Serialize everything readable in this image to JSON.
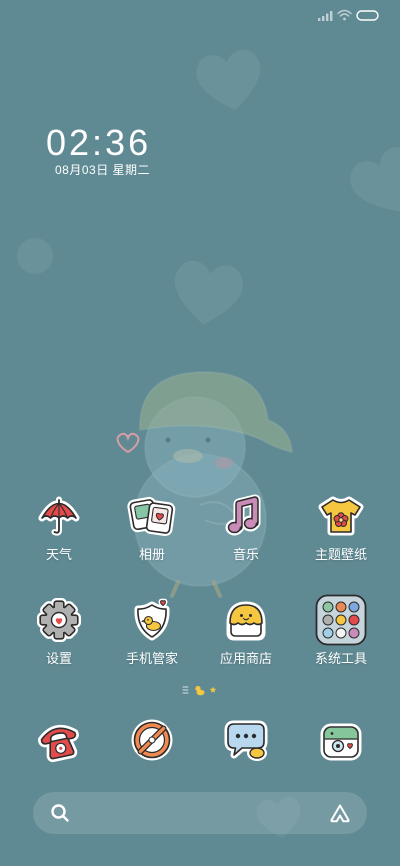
{
  "colors": {
    "background": "#5f8a93",
    "label_text": "#ffffff",
    "accent_red": "#e34b4b",
    "accent_yellow": "#f5c640"
  },
  "status_bar": {
    "icons": [
      "signal-icon",
      "wifi-icon",
      "battery-icon"
    ]
  },
  "clock": {
    "time": "02:36",
    "date": "08月03日 星期二"
  },
  "home_grid": [
    {
      "label": "天气",
      "icon": "umbrella-icon"
    },
    {
      "label": "相册",
      "icon": "photo-frames-icon"
    },
    {
      "label": "音乐",
      "icon": "music-note-icon"
    },
    {
      "label": "主题壁纸",
      "icon": "tshirt-icon"
    },
    {
      "label": "设置",
      "icon": "gear-icon"
    },
    {
      "label": "手机管家",
      "icon": "shield-duck-icon"
    },
    {
      "label": "应用商店",
      "icon": "store-bag-icon"
    },
    {
      "label": "系统工具",
      "icon": "folder-icon"
    }
  ],
  "page_indicator": {
    "icons": [
      "feed-page-icon",
      "duck-page-icon",
      "star-page-icon"
    ],
    "current": "duck-page-icon"
  },
  "dock": [
    {
      "icon": "phone-icon"
    },
    {
      "icon": "browser-icon"
    },
    {
      "icon": "messages-icon"
    },
    {
      "icon": "camera-icon"
    }
  ],
  "search_bar": {
    "search_icon": "search-icon",
    "assistant_icon": "assistant-icon"
  }
}
